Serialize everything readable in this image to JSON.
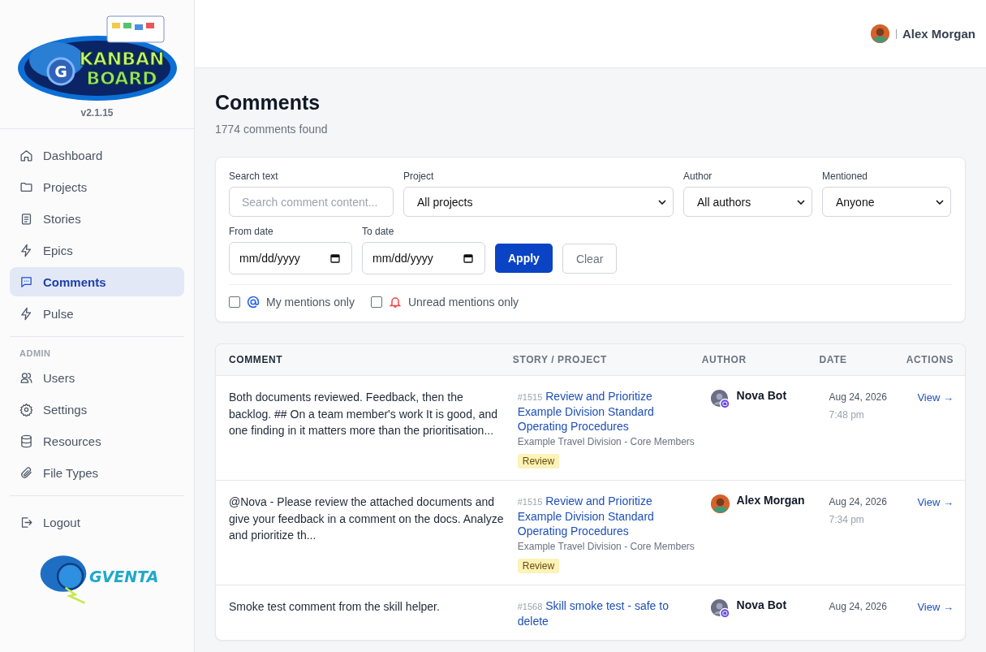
{
  "sidebar": {
    "logo": {
      "badge": "G",
      "title_lines": [
        "KANBAN",
        "BOARD"
      ]
    },
    "version": "v2.1.15",
    "nav": [
      {
        "label": "Dashboard",
        "selected": false
      },
      {
        "label": "Projects",
        "selected": false
      },
      {
        "label": "Stories",
        "selected": false
      },
      {
        "label": "Epics",
        "selected": false
      },
      {
        "label": "Comments",
        "selected": true
      },
      {
        "label": "Pulse",
        "selected": false
      }
    ],
    "admin_heading": "ADMIN",
    "admin": [
      {
        "label": "Users",
        "selected": false
      },
      {
        "label": "Settings",
        "selected": false
      },
      {
        "label": "Resources",
        "selected": false
      },
      {
        "label": "File Types",
        "selected": false
      }
    ],
    "logout": "Logout",
    "brand": "GVENTA"
  },
  "header": {
    "user": "Alex Morgan"
  },
  "page": {
    "title": "Comments",
    "subtitle": "1774 comments found"
  },
  "filters": {
    "search": {
      "label": "Search text",
      "placeholder": "Search comment content..."
    },
    "project": {
      "label": "Project",
      "value": "All projects"
    },
    "author": {
      "label": "Author",
      "value": "All authors"
    },
    "mentioned": {
      "label": "Mentioned",
      "value": "Anyone"
    },
    "from_date": {
      "label": "From date",
      "value": "mm/dd/yyyy"
    },
    "to_date": {
      "label": "To date",
      "value": "mm/dd/yyyy"
    },
    "apply": "Apply",
    "clear": "Clear",
    "checks": [
      {
        "label": "My mentions only",
        "checked": false
      },
      {
        "label": "Unread mentions only",
        "checked": false
      }
    ]
  },
  "table": {
    "columns": [
      "COMMENT",
      "STORY / PROJECT",
      "AUTHOR",
      "DATE",
      "ACTIONS"
    ],
    "rows": [
      {
        "comment": "Both documents reviewed. Feedback, then the backlog. ## On a team member's work It is good, and one finding in it matters more than the prioritisation...",
        "story_id": "#1515",
        "story": "Review and Prioritize  Example Division Standard Operating Procedures",
        "project": "Example Travel Division - Core Members",
        "status": "Review",
        "author": "Nova Bot",
        "bot": true,
        "date": "Aug 24, 2026",
        "time": "7:48 pm",
        "action": "View →"
      },
      {
        "comment": "@Nova  -  Please review the attached documents and give your feedback in a comment on the docs. Analyze and prioritize th...",
        "story_id": "#1515",
        "story": "Review and Prioritize Example Division Standard Operating Procedures",
        "project": "Example Travel Division - Core Members",
        "status": "Review",
        "author": "Alex Morgan",
        "bot": false,
        "date": "Aug 24, 2026",
        "time": "7:34 pm",
        "action": "View →"
      },
      {
        "comment": "Smoke test comment from the skill helper.",
        "story_id": "#1568",
        "story": "Skill smoke test - safe to delete",
        "author": "Nova Bot",
        "bot": true,
        "date": "Aug 24, 2026",
        "action": "View →"
      }
    ]
  }
}
